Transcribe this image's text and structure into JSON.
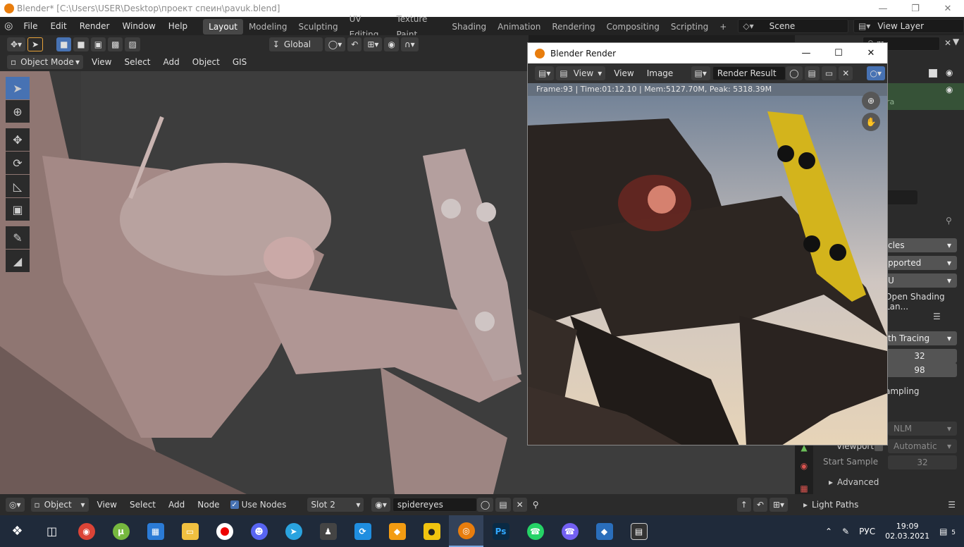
{
  "window": {
    "title": "Blender* [C:\\Users\\USER\\Desktop\\проект спеин\\pavuk.blend]"
  },
  "menu": [
    "File",
    "Edit",
    "Render",
    "Window",
    "Help"
  ],
  "workspaces": [
    "Layout",
    "Modeling",
    "Sculpting",
    "UV Editing",
    "Texture Paint",
    "Shading",
    "Animation",
    "Rendering",
    "Compositing",
    "Scripting"
  ],
  "scene": {
    "label": "Scene",
    "view_layer": "View Layer"
  },
  "viewport_header": {
    "transform": "Global",
    "mode": "Object Mode",
    "menus": [
      "View",
      "Select",
      "Add",
      "Object",
      "GIS"
    ]
  },
  "render_window": {
    "title": "Blender Render",
    "menus": [
      "View",
      "View",
      "Image"
    ],
    "image_name": "Render Result",
    "info": "Frame:93 | Time:01:12.10 | Mem:5127.70M, Peak: 5318.39M"
  },
  "properties": {
    "search_fragment": "m",
    "partial_labels": [
      "cles",
      "pported",
      "U",
      "Open Shading Lan..."
    ],
    "light_paths_label": "th Tracing",
    "samples_render": "32",
    "samples_viewport": "98",
    "sampling_partial": "ampling",
    "denoise_render": "NLM",
    "viewport_label": "Viewport",
    "viewport_value": "Automatic",
    "start_sample_label": "Start Sample",
    "start_sample_value": "32",
    "advanced_label": "Advanced",
    "light_paths": "Light Paths",
    "outliner_partial": "ra"
  },
  "bottom": {
    "mode": "Object",
    "menus": [
      "View",
      "Select",
      "Add",
      "Node"
    ],
    "use_nodes_label": "Use Nodes",
    "slot": "Slot 2",
    "material": "spidereyes"
  },
  "taskbar": {
    "lang": "РУС",
    "time": "19:09",
    "date": "02.03.2021",
    "notifications": "5"
  },
  "colors": {
    "accent": "#4772b3",
    "header": "#2b2b2b",
    "active_tab": "#474747"
  }
}
